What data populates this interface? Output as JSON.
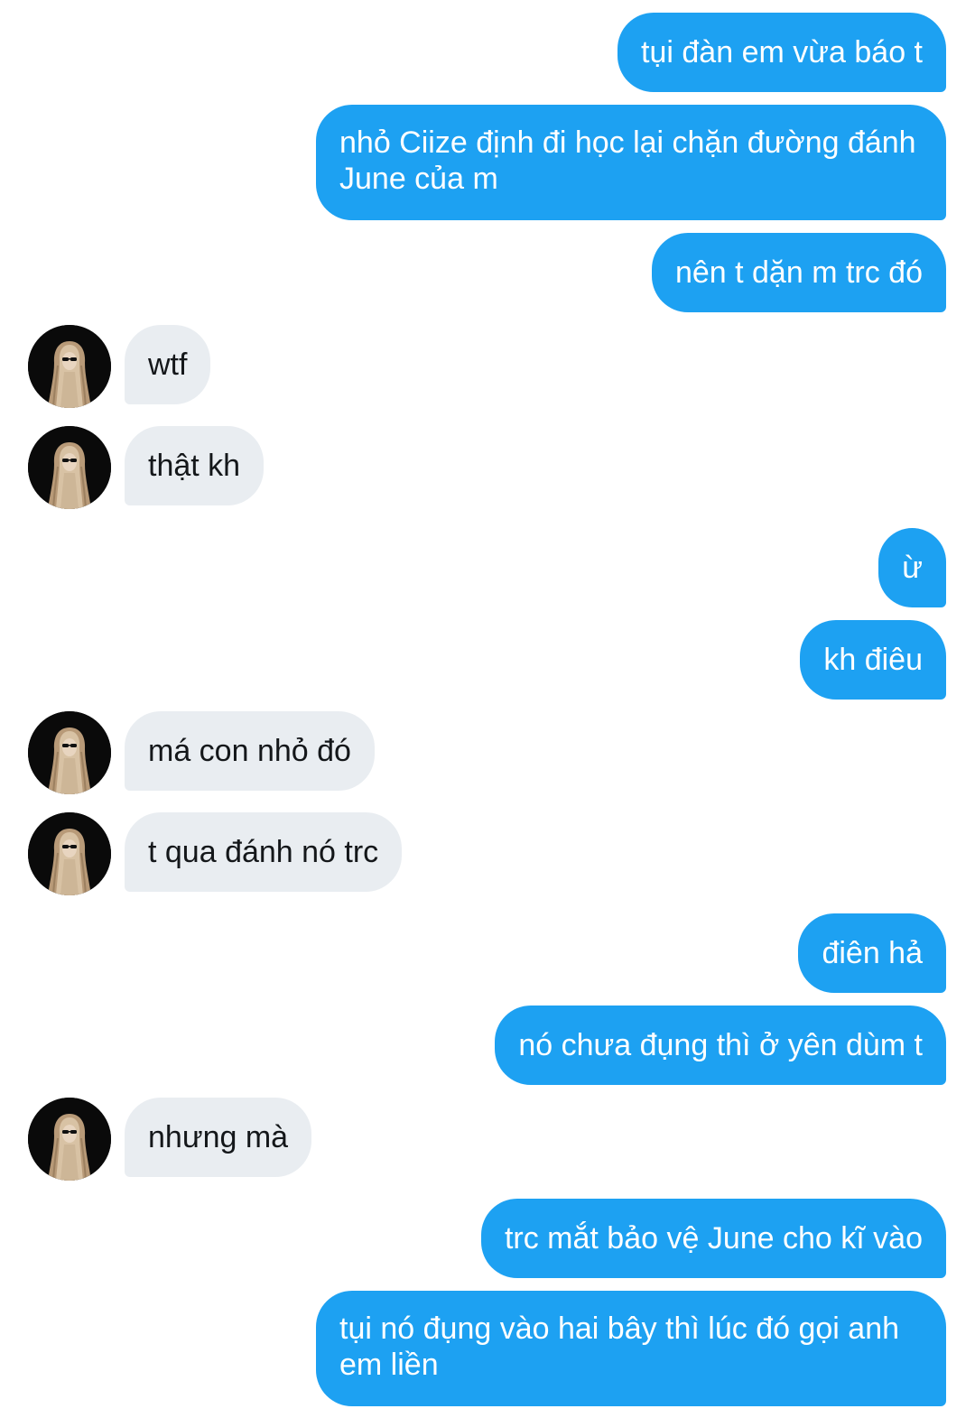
{
  "conversation": {
    "contact_avatar_icon": "contact-avatar-icon",
    "colors": {
      "outgoing_bubble": "#1da1f2",
      "incoming_bubble": "#e9edf1",
      "outgoing_text": "#ffffff",
      "incoming_text": "#14171a"
    },
    "messages": [
      {
        "side": "outgoing",
        "text": "tụi đàn em vừa báo t"
      },
      {
        "side": "outgoing",
        "text": "nhỏ Ciize định đi học lại chặn đường đánh June của m"
      },
      {
        "side": "outgoing",
        "text": "nên t dặn m trc đó"
      },
      {
        "side": "incoming",
        "text": "wtf"
      },
      {
        "side": "incoming",
        "text": "thật kh"
      },
      {
        "side": "outgoing",
        "text": "ừ"
      },
      {
        "side": "outgoing",
        "text": "kh điêu"
      },
      {
        "side": "incoming",
        "text": "má con nhỏ đó"
      },
      {
        "side": "incoming",
        "text": "t qua đánh nó trc"
      },
      {
        "side": "outgoing",
        "text": "điên hả"
      },
      {
        "side": "outgoing",
        "text": "nó chưa đụng thì ở yên dùm t"
      },
      {
        "side": "incoming",
        "text": "nhưng mà"
      },
      {
        "side": "outgoing",
        "text": "trc mắt bảo vệ June cho kĩ vào"
      },
      {
        "side": "outgoing",
        "text": "tụi nó đụng vào hai bây thì lúc đó gọi anh em liền"
      }
    ]
  }
}
